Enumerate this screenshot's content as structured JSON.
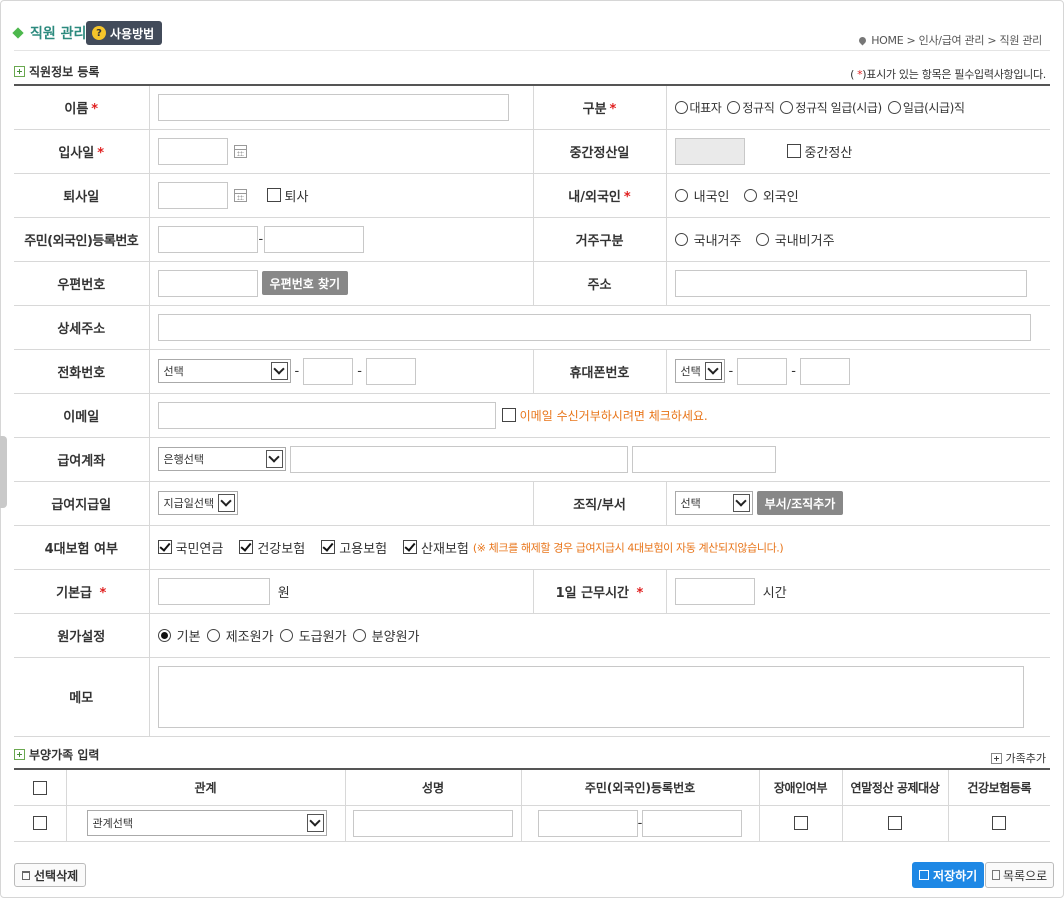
{
  "header": {
    "title": "직원 관리",
    "help_label": "사용방법",
    "help_icon_glyph": "?",
    "breadcrumb": [
      "HOME",
      "인사/급여 관리",
      "직원 관리"
    ]
  },
  "section_staff": {
    "title": "직원정보 등록",
    "required_note_prefix": "(",
    "required_note_star": "*",
    "required_note_suffix": ")표시가 있는 항목은 필수입력사항입니다."
  },
  "form": {
    "name_label": "이름",
    "type_label": "구분",
    "type_options": [
      "대표자",
      "정규직",
      "정규직 일급(시급)",
      "일급(시급)직"
    ],
    "hire_date_label": "입사일",
    "mid_settle_date_label": "중간정산일",
    "mid_settle_check": "중간정산",
    "leave_date_label": "퇴사일",
    "leave_check": "퇴사",
    "nationality_label": "내/외국인",
    "nationality_options": [
      "내국인",
      "외국인"
    ],
    "resident_id_label": "주민(외국인)등록번호",
    "residence_label": "거주구분",
    "residence_options": [
      "국내거주",
      "국내비거주"
    ],
    "postcode_label": "우편번호",
    "postcode_button": "우편번호 찾기",
    "address_label": "주소",
    "detail_address_label": "상세주소",
    "phone_label": "전화번호",
    "phone_select": "선택",
    "mobile_label": "휴대폰번호",
    "mobile_select": "선택",
    "email_label": "이메일",
    "email_optout": "이메일 수신거부하시려면 체크하세요.",
    "bank_label": "급여계좌",
    "bank_select": "은행선택",
    "payday_label": "급여지급일",
    "payday_select": "지급일선택",
    "dept_label": "조직/부서",
    "dept_select": "선택",
    "dept_button": "부서/조직추가",
    "insurance_label": "4대보험 여부",
    "insurance_options": [
      "국민연금",
      "건강보험",
      "고용보험",
      "산재보험"
    ],
    "insurance_note": "(※ 체크를 해제할 경우 급여지급시 4대보험이 자동 계산되지않습니다.)",
    "base_pay_label": "기본급",
    "base_pay_unit": "원",
    "daily_hours_label": "1일 근무시간",
    "daily_hours_unit": "시간",
    "cost_label": "원가설정",
    "cost_options": [
      "기본",
      "제조원가",
      "도급원가",
      "분양원가"
    ],
    "memo_label": "메모"
  },
  "section_family": {
    "title": "부양가족 입력",
    "add_label": "가족추가",
    "columns": [
      "관계",
      "성명",
      "주민(외국인)등록번호",
      "장애인여부",
      "연말정산 공제대상",
      "건강보험등록"
    ],
    "row_relation_select": "관계선택"
  },
  "footer": {
    "delete_label": "선택삭제",
    "save_label": "저장하기",
    "list_label": "목록으로"
  }
}
